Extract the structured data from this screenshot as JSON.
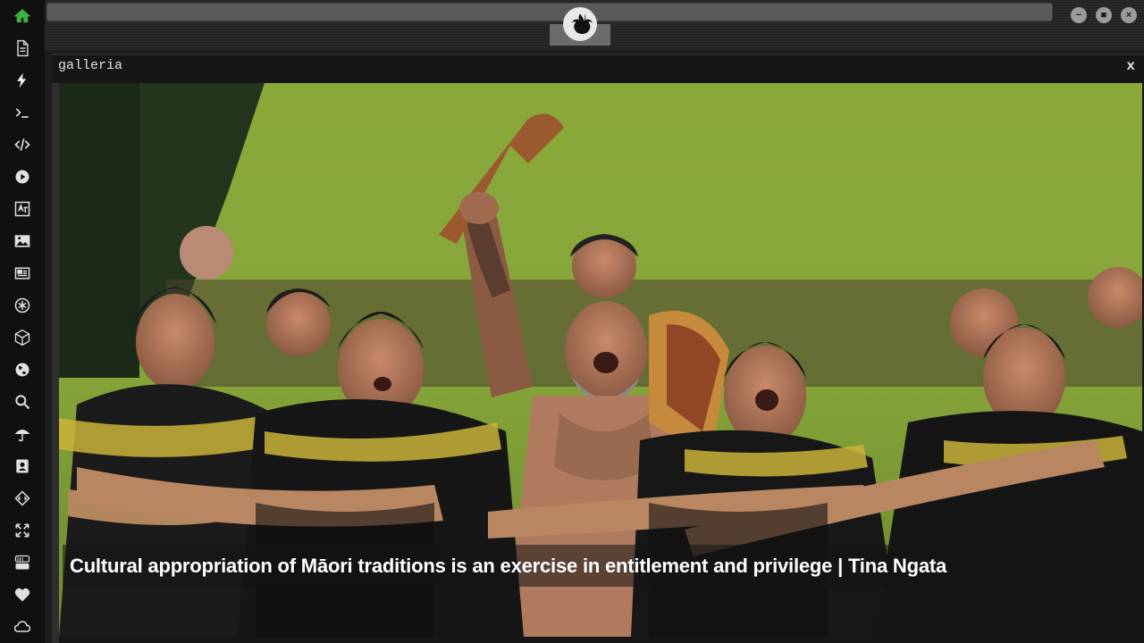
{
  "sidebar": {
    "items": [
      {
        "icon": "home-icon",
        "active": true
      },
      {
        "icon": "document-icon"
      },
      {
        "icon": "lightning-icon"
      },
      {
        "icon": "terminal-icon"
      },
      {
        "icon": "code-icon"
      },
      {
        "icon": "play-icon"
      },
      {
        "icon": "translate-icon"
      },
      {
        "icon": "image-icon"
      },
      {
        "icon": "newspaper-icon"
      },
      {
        "icon": "asterisk-icon"
      },
      {
        "icon": "cube-icon"
      },
      {
        "icon": "globe-icon"
      },
      {
        "icon": "search-icon"
      },
      {
        "icon": "umbrella-icon"
      },
      {
        "icon": "contact-card-icon"
      },
      {
        "icon": "code-diamond-icon"
      },
      {
        "icon": "expand-icon"
      },
      {
        "icon": "youtube-icon"
      },
      {
        "icon": "heart-icon"
      },
      {
        "icon": "cloud-icon"
      }
    ],
    "active_color": "#3fb043"
  },
  "window": {
    "title": "galleria",
    "close_label": "x"
  },
  "gallery": {
    "caption": "Cultural appropriation of Māori traditions is an exercise in entitlement and privilege | Tina Ngata"
  },
  "colors": {
    "background": "#1d1d1d",
    "sidebar": "#101010",
    "active": "#3fb043"
  }
}
